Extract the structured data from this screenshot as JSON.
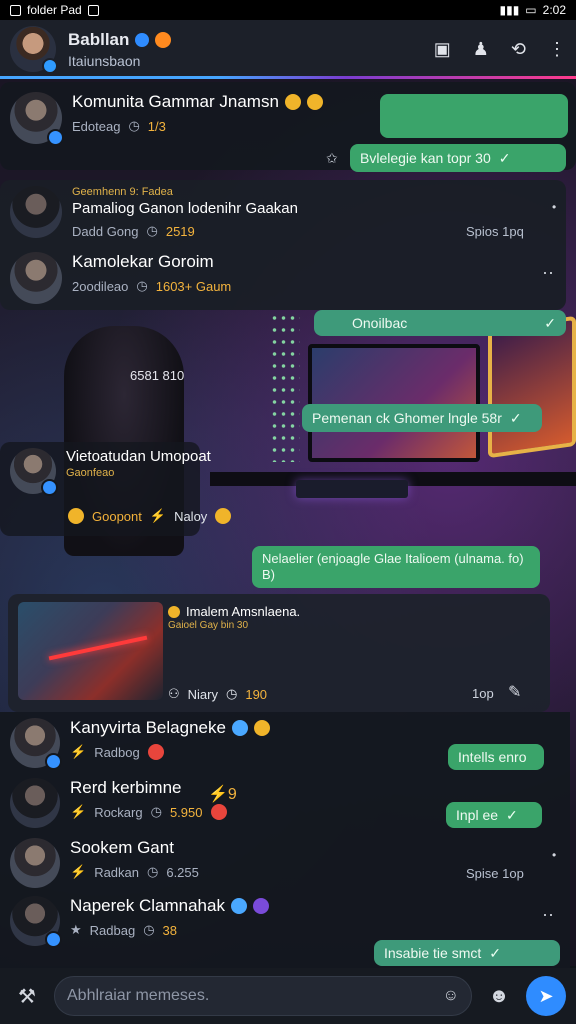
{
  "statusbar": {
    "left_text": "folder Pad",
    "right_text": "2:02"
  },
  "header": {
    "title": "Babllan",
    "subtitle": "Itaiunsbaon"
  },
  "chats": [
    {
      "title": "Komunita Gammar Jnamsn",
      "sub_label": "Edoteag",
      "sub_num": "1/3"
    },
    {
      "title_small": "Geemhenn 9: Fadea",
      "title": "Pamaliog Ganon lodenihr Gaakan",
      "sub_label": "Dadd Gong",
      "sub_num": "2519"
    },
    {
      "title": "Kamolekar Goroim",
      "sub_label": "2oodileao",
      "sub_num": "1603+ Gaum"
    },
    {
      "title": "Vietoatudan Umopoat",
      "sub_label": "Gaonfeao",
      "sub_extra": "Goopont",
      "sub_extra2": "Naloy"
    },
    {
      "title": "Kanyvirta Belagneke",
      "sub_label": "Radbog"
    },
    {
      "title": "Rerd kerbimne",
      "sub_label": "Rockarg",
      "sub_num": "5.950"
    },
    {
      "title": "Sookem Gant",
      "sub_label": "Radkan",
      "sub_num": "6.255"
    },
    {
      "title": "Naperek Clamnahak",
      "sub_label": "Radbag",
      "sub_num": "38"
    }
  ],
  "bubbles": {
    "b1": "Bvlelegie kan topr 30",
    "b2": "Onoilbac",
    "b3": "Pemenan ck Ghomer lngle 58r",
    "b4": "Nelaelier (enjoagle Glae Italioem (ulnama. fo) B)",
    "b5": "Intells enro",
    "b6": "Inpl ee",
    "b7": "Insabie tie smct"
  },
  "times": {
    "t1": "Spios 1pq",
    "t2": "1op",
    "t3": "Spise 1op"
  },
  "scene_label": "6581 810",
  "image_card": {
    "title": "Imalem Amsnlaena.",
    "meta": "Gaioel Gay bin 30",
    "footer_left": "Niary",
    "footer_num": "190",
    "footer_time": "1op"
  },
  "composer": {
    "placeholder": "Abhlraiar memeses."
  },
  "colors": {
    "accent": "#2f8cff",
    "bubble_green": "#3aa46a",
    "header_bg": "#1c2029"
  }
}
